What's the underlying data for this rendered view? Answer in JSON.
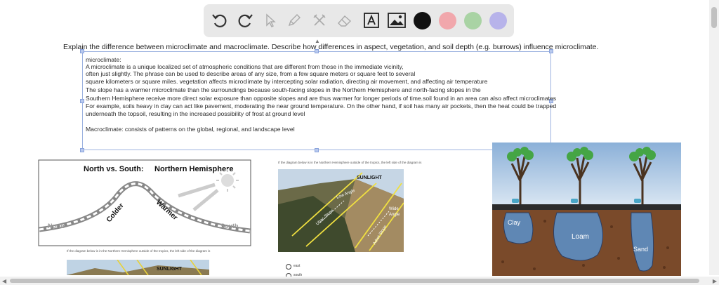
{
  "toolbar": {
    "tools": [
      "undo-icon",
      "redo-icon",
      "pointer-icon",
      "pencil-icon",
      "tools-icon",
      "eraser-icon",
      "text-icon",
      "image-icon"
    ],
    "colors": [
      "#111111",
      "#f1a7ac",
      "#a9d3a4",
      "#b7b3ea"
    ]
  },
  "question": "Explain the difference between microclimate and macroclimate. Describe how differences in aspect, vegetation, and soil depth (e.g. burrows) influence microclimate.",
  "answer": {
    "lines": [
      "microclimate:",
      "A microclimate is a unique localized set of atmospheric conditions that are different from those in the immediate vicinity,",
      " often just slightly. The phrase can be used to describe areas of any size, from a few square meters or square feet to several",
      "square kilometers or square miles. vegetation affects microclimate by intercepting solar radiation, directing air movement, and affecting air temperature",
      "The slope has a warmer microclimate than the surroundings because south-facing slopes in the Northern Hemisphere and north-facing slopes in the",
      "Southern Hemisphere receive more direct solar exposure than opposite slopes and are thus warmer for longer periods of time.soil found in an area can also affect microclimates",
      "For example, soils heavy in clay can act like pavement, moderating the near ground temperature. On the other hand, if soil has many air pockets, then the heat could be trapped",
      "underneath the topsoil, resulting in the increased possibility of frost at ground level"
    ],
    "macro": "Macroclimate: consists of patterns on the global, regional, and landscape level"
  },
  "diagram1": {
    "title_bold": "North vs. South:",
    "title_rest": " Northern Hemisphere",
    "north": "North",
    "south": "South",
    "colder": "Colder",
    "warmer": "Warmer",
    "caption": "If the diagram below is in the Northern Hemisphere outside of the tropics, the left side of the diagram is"
  },
  "diagram2": {
    "caption": "If the diagram below is in the Northern Hemisphere outside of the tropics, the left side of the diagram is",
    "sunlight": "SUNLIGHT",
    "low_angle": "Low Angle",
    "ubac": "Ubac Slope",
    "wide1": "Wide",
    "wide2": "Angle",
    "adret": "Adret Slope",
    "options": [
      "east",
      "south"
    ]
  },
  "diagram3": {
    "sunlight": "SUNLIGHT"
  },
  "soil": {
    "clay": "Clay",
    "loam": "Loam",
    "sand": "Sand"
  }
}
